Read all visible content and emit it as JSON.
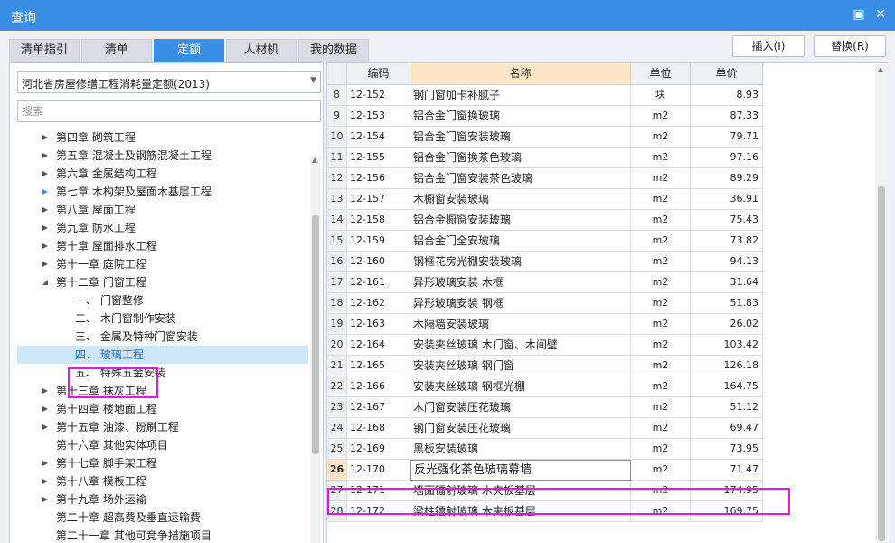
{
  "window": {
    "title": "查询"
  },
  "tabs": [
    "清单指引",
    "清单",
    "定额",
    "人材机",
    "我的数据"
  ],
  "actions": {
    "insert": "插入(I)",
    "replace": "替换(R)"
  },
  "library": {
    "selected": "河北省房屋修缮工程消耗量定额(2013)"
  },
  "search": {
    "placeholder": "搜索"
  },
  "tree": [
    {
      "label": "第四章 砌筑工程",
      "expander": "collapsed"
    },
    {
      "label": "第五章 混凝土及钢筋混凝土工程",
      "expander": "collapsed"
    },
    {
      "label": "第六章 金属结构工程",
      "expander": "collapsed"
    },
    {
      "label": "第七章 木构架及屋面木基层工程",
      "expander": "collapsed"
    },
    {
      "label": "第八章 屋面工程",
      "expander": "collapsed"
    },
    {
      "label": "第九章 防水工程",
      "expander": "collapsed"
    },
    {
      "label": "第十章 屋面排水工程",
      "expander": "collapsed"
    },
    {
      "label": "第十一章 庭院工程",
      "expander": "collapsed"
    },
    {
      "label": "第十二章 门窗工程",
      "expander": "expanded"
    },
    {
      "label": "一、 门窗整修",
      "expander": "none"
    },
    {
      "label": "二、 木门窗制作安装",
      "expander": "none"
    },
    {
      "label": "三、 金属及特种门窗安装",
      "expander": "none"
    },
    {
      "label": "四、 玻璃工程",
      "expander": "none"
    },
    {
      "label": "五、 特殊五金安装",
      "expander": "none"
    },
    {
      "label": "第十三章 抹灰工程",
      "expander": "collapsed"
    },
    {
      "label": "第十四章 楼地面工程",
      "expander": "collapsed"
    },
    {
      "label": "第十五章 油漆、粉刷工程",
      "expander": "collapsed"
    },
    {
      "label": "第十六章 其他实体项目",
      "expander": "none"
    },
    {
      "label": "第十七章 脚手架工程",
      "expander": "collapsed"
    },
    {
      "label": "第十八章 模板工程",
      "expander": "collapsed"
    },
    {
      "label": "第十九章 场外运输",
      "expander": "collapsed"
    },
    {
      "label": "第二十章 超高费及垂直运输费",
      "expander": "none"
    },
    {
      "label": "第二十一章 其他可竞争措施项目",
      "expander": "none"
    }
  ],
  "grid": {
    "columns": [
      "编码",
      "名称",
      "单位",
      "单价"
    ],
    "rows": [
      {
        "n": "8",
        "code": "12-152",
        "name": "钢门窗加卡补腻子",
        "unit": "块",
        "price": "8.93"
      },
      {
        "n": "9",
        "code": "12-153",
        "name": "铝合金门窗换玻璃",
        "unit": "m2",
        "price": "87.33"
      },
      {
        "n": "10",
        "code": "12-154",
        "name": "铝合金门窗安装玻璃",
        "unit": "m2",
        "price": "79.71"
      },
      {
        "n": "11",
        "code": "12-155",
        "name": "铝合金门窗换茶色玻璃",
        "unit": "m2",
        "price": "97.16"
      },
      {
        "n": "12",
        "code": "12-156",
        "name": "铝合金门窗安装茶色玻璃",
        "unit": "m2",
        "price": "89.29"
      },
      {
        "n": "13",
        "code": "12-157",
        "name": "木橱窗安装玻璃",
        "unit": "m2",
        "price": "36.91"
      },
      {
        "n": "14",
        "code": "12-158",
        "name": "铝合金橱窗安装玻璃",
        "unit": "m2",
        "price": "75.43"
      },
      {
        "n": "15",
        "code": "12-159",
        "name": "铝合金门全安玻璃",
        "unit": "m2",
        "price": "73.82"
      },
      {
        "n": "16",
        "code": "12-160",
        "name": "钢框花房光棚安装玻璃",
        "unit": "m2",
        "price": "94.13"
      },
      {
        "n": "17",
        "code": "12-161",
        "name": "异形玻璃安装 木框",
        "unit": "m2",
        "price": "31.64"
      },
      {
        "n": "18",
        "code": "12-162",
        "name": "异形玻璃安装 钢框",
        "unit": "m2",
        "price": "51.83"
      },
      {
        "n": "19",
        "code": "12-163",
        "name": "木隔墙安装玻璃",
        "unit": "m2",
        "price": "26.02"
      },
      {
        "n": "20",
        "code": "12-164",
        "name": "安装夹丝玻璃 木门窗、木间壁",
        "unit": "m2",
        "price": "103.42"
      },
      {
        "n": "21",
        "code": "12-165",
        "name": "安装夹丝玻璃 钢门窗",
        "unit": "m2",
        "price": "126.18"
      },
      {
        "n": "22",
        "code": "12-166",
        "name": "安装夹丝玻璃 钢框光棚",
        "unit": "m2",
        "price": "164.75"
      },
      {
        "n": "23",
        "code": "12-167",
        "name": "木门窗安装压花玻璃",
        "unit": "m2",
        "price": "51.12"
      },
      {
        "n": "24",
        "code": "12-168",
        "name": "钢门窗安装压花玻璃",
        "unit": "m2",
        "price": "69.47"
      },
      {
        "n": "25",
        "code": "12-169",
        "name": "黑板安装玻璃",
        "unit": "m2",
        "price": "73.95"
      },
      {
        "n": "26",
        "code": "12-170",
        "name": "反光强化茶色玻璃幕墙",
        "unit": "m2",
        "price": "71.47",
        "current": true
      },
      {
        "n": "27",
        "code": "12-171",
        "name": "墙面镭射玻璃 木夹板基层",
        "unit": "m2",
        "price": "174.95"
      },
      {
        "n": "28",
        "code": "12-172",
        "name": "梁柱镭射玻璃 木夹板基层",
        "unit": "m2",
        "price": "169.75"
      }
    ]
  },
  "colors": {
    "accent": "#3a8ee6",
    "selection": "#cde6fa",
    "highlight_box": "#e01ae0",
    "header_accent": "#fde6c7"
  }
}
